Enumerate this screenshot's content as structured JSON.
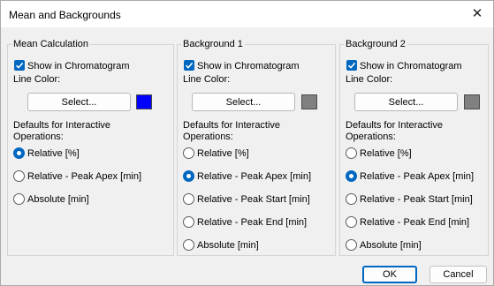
{
  "window": {
    "title": "Mean and Backgrounds",
    "close_glyph": "✕"
  },
  "common": {
    "show_label": "Show in Chromatogram",
    "line_color_label": "Line Color:",
    "select_label": "Select...",
    "defaults_label_1": "Defaults for Interactive",
    "defaults_label_2": "Operations:"
  },
  "groups": [
    {
      "title": "Mean Calculation",
      "color": "#0000ff",
      "options": [
        "Relative [%]",
        "Relative - Peak Apex [min]",
        "Absolute [min]"
      ],
      "selected": "Relative [%]"
    },
    {
      "title": "Background 1",
      "color": "#808080",
      "options": [
        "Relative [%]",
        "Relative - Peak Apex [min]",
        "Relative - Peak Start [min]",
        "Relative - Peak End [min]",
        "Absolute [min]"
      ],
      "selected": "Relative - Peak Apex [min]"
    },
    {
      "title": "Background 2",
      "color": "#808080",
      "options": [
        "Relative [%]",
        "Relative - Peak Apex [min]",
        "Relative - Peak Start [min]",
        "Relative - Peak End [min]",
        "Absolute [min]"
      ],
      "selected": "Relative - Peak Apex [min]"
    }
  ],
  "footer": {
    "ok_label": "OK",
    "cancel_label": "Cancel"
  }
}
